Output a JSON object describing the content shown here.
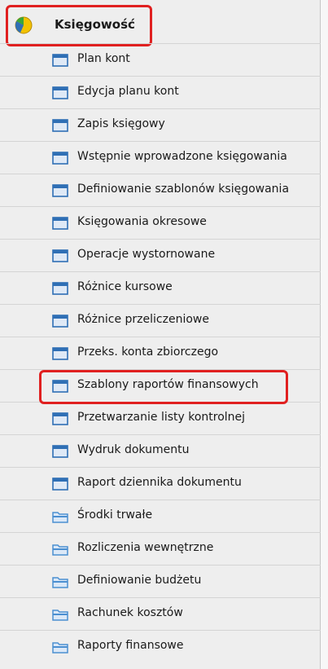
{
  "header": {
    "label": "Księgowość",
    "icon": "pie-chart-icon"
  },
  "items": [
    {
      "label": "Plan kont",
      "icon": "window-icon"
    },
    {
      "label": "Edycja planu kont",
      "icon": "window-icon"
    },
    {
      "label": "Zapis księgowy",
      "icon": "window-icon"
    },
    {
      "label": "Wstępnie wprowadzone księgowania",
      "icon": "window-icon"
    },
    {
      "label": "Definiowanie szablonów księgowania",
      "icon": "window-icon"
    },
    {
      "label": "Księgowania okresowe",
      "icon": "window-icon"
    },
    {
      "label": "Operacje wystornowane",
      "icon": "window-icon"
    },
    {
      "label": "Różnice kursowe",
      "icon": "window-icon"
    },
    {
      "label": "Różnice przeliczeniowe",
      "icon": "window-icon"
    },
    {
      "label": "Przeks. konta zbiorczego",
      "icon": "window-icon"
    },
    {
      "label": "Szablony raportów finansowych",
      "icon": "window-icon"
    },
    {
      "label": "Przetwarzanie listy kontrolnej",
      "icon": "window-icon"
    },
    {
      "label": "Wydruk dokumentu",
      "icon": "window-icon"
    },
    {
      "label": "Raport dziennika dokumentu",
      "icon": "window-icon"
    },
    {
      "label": "Środki trwałe",
      "icon": "folder-icon"
    },
    {
      "label": "Rozliczenia wewnętrzne",
      "icon": "folder-icon"
    },
    {
      "label": "Definiowanie budżetu",
      "icon": "folder-icon"
    },
    {
      "label": "Rachunek kosztów",
      "icon": "folder-icon"
    },
    {
      "label": "Raporty finansowe",
      "icon": "folder-icon"
    }
  ],
  "colors": {
    "highlight": "#e02020",
    "window_icon": "#2f6fb5",
    "folder_icon": "#4b8fd1"
  }
}
